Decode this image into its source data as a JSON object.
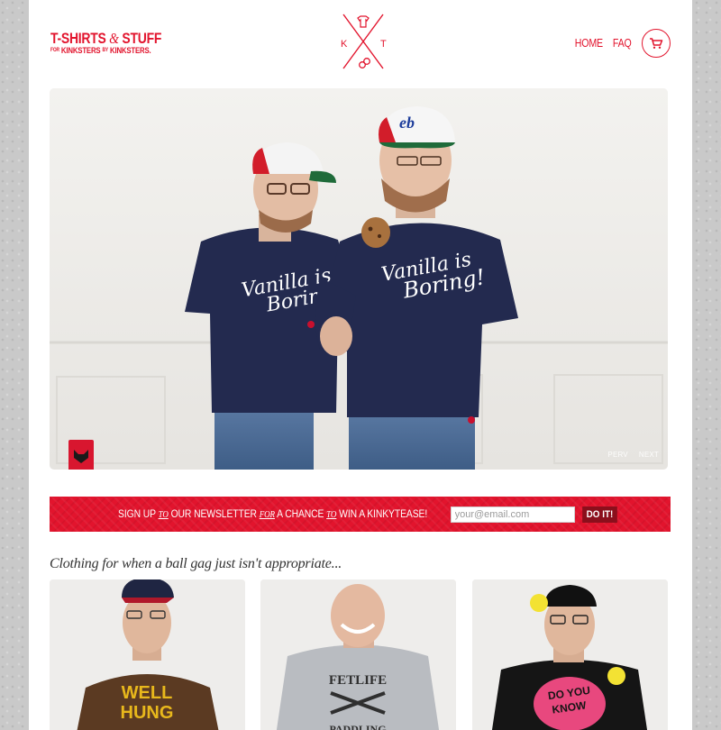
{
  "header": {
    "logo_line1_a": "T-SHIRTS",
    "logo_line1_amp": "&",
    "logo_line1_b": "STUFF",
    "logo_line2_a": "FOR",
    "logo_line2_b": "KINKSTERS",
    "logo_line2_c": "BY",
    "logo_line2_d": "KINKSTERS.",
    "emblem_k": "K",
    "emblem_t": "T",
    "nav_home": "HOME",
    "nav_faq": "FAQ"
  },
  "hero": {
    "shirt_text_line1": "Vanilla is",
    "shirt_text_line2": "Boring!",
    "prev_label": "PERV",
    "next_label": "NEXT"
  },
  "newsletter": {
    "part1": "SIGN UP",
    "to1": "TO",
    "part2": "OUR NEWSLETTER",
    "for": "FOR",
    "part3": "A CHANCE",
    "to2": "TO",
    "part4": "WIN A KINKYTEASE!",
    "placeholder": "your@email.com",
    "button": "DO IT!"
  },
  "tagline": "Clothing for when a ball gag just isn't appropriate...",
  "products": [
    {
      "shirt_line1": "WELL",
      "shirt_line2": "HUNG",
      "shirt_color": "#5b3a22"
    },
    {
      "shirt_line1": "FETLIFE",
      "shirt_line2": "PADDLING",
      "shirt_color": "#b9bcc1"
    },
    {
      "shirt_line1": "DO YOU",
      "shirt_line2": "KNOW",
      "shirt_color": "#151515"
    }
  ],
  "colors": {
    "accent": "#e2142d",
    "button_dark": "#8b0f1c",
    "navy_shirt": "#232a4f"
  }
}
